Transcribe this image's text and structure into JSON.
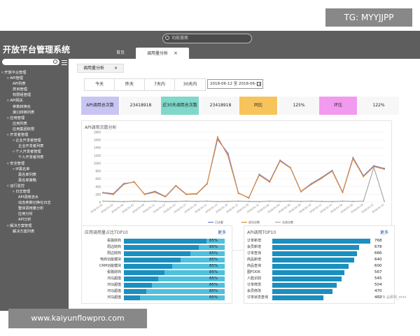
{
  "watermarks": {
    "top": "TG: MYYJJPP",
    "bottom": "www.kaiyunflowpro.com",
    "credit": "CSDN @慕锦_mini"
  },
  "app": {
    "title": "开放平台管理系统",
    "search_placeholder": "功能搜索"
  },
  "tabs": [
    {
      "label": "首页"
    },
    {
      "label": "调用量分析",
      "close": "×"
    }
  ],
  "sidebar": {
    "tree": [
      "▿ 开放平台管理",
      "▿ API管理",
      "API列表",
      "类目管理",
      "权限组管理",
      "▿ API网关",
      "参数转换化",
      "接口转换列表",
      "▿ 应用管理",
      "应用列表",
      "应用集团权限",
      "▿ 开发者管理",
      "▿ 企业开发者管理",
      "企业开发者列表",
      "▿ 个人开发者管理",
      "个人开发者列表",
      "▿ 安全管理",
      "▿ IP黑名单",
      "黑名单列表",
      "黑名单策略",
      "▿ 运行监控",
      "▿ 日志管理",
      "API调用流水",
      "动态参数切换化日志",
      "整体调用量分析",
      "应用分析",
      "API分析",
      "▿ 解决方案管理",
      "解决方案列表"
    ],
    "indents": [
      0,
      1,
      2,
      2,
      2,
      1,
      2,
      2,
      1,
      2,
      2,
      1,
      2,
      3,
      2,
      3,
      1,
      2,
      3,
      3,
      1,
      2,
      3,
      3,
      3,
      3,
      3,
      1,
      2
    ]
  },
  "subtab": {
    "label": "调用量分析",
    "close": "×"
  },
  "periods": [
    "今天",
    "昨天",
    "7天内",
    "30天内"
  ],
  "date_range": "2018-06-12 至 2018-06-12",
  "stats": [
    {
      "label": "API调用总次数",
      "color": "#c9c5f2"
    },
    {
      "label": "23418918",
      "color": "#f7f7f7"
    },
    {
      "label": "近30天调用总次数",
      "color": "#7fd8c9"
    },
    {
      "label": "23418918",
      "color": "#f7f7f7"
    },
    {
      "label": "同比",
      "color": "#f7c45c"
    },
    {
      "label": "125%",
      "color": "#f7f7f7"
    },
    {
      "label": "环比",
      "color": "#f29af0"
    },
    {
      "label": "122%",
      "color": "#f7f7f7"
    }
  ],
  "chart_data": {
    "type": "line",
    "title": "API调用次数分析",
    "ylim": [
      0,
      1800
    ],
    "yticks": [
      "1800",
      "1600",
      "1400",
      "1200",
      "1000",
      "800",
      "600",
      "400",
      "200",
      "0"
    ],
    "categories": [
      "2018-01-01",
      "2018-01-03",
      "2018-01-05",
      "2018-01-07",
      "2018-01-09",
      "2018-01-11",
      "2018-01-13",
      "2018-01-15",
      "2018-01-17",
      "2018-01-19",
      "2018-01-21",
      "2018-01-23",
      "2018-01-25",
      "2018-01-27",
      "2018-01-29",
      "2018-01-31",
      "2018-02-02",
      "2018-02-04",
      "2018-02-06",
      "2018-02-08",
      "2018-02-10",
      "2018-02-12",
      "2018-02-14",
      "2018-02-16",
      "2018-02-18",
      "2018-02-20",
      "2018-02-22",
      "2018-02-24"
    ],
    "series": [
      {
        "name": "日访客",
        "color": "#6c7bc8",
        "values": [
          250,
          220,
          480,
          520,
          210,
          280,
          150,
          430,
          210,
          220,
          480,
          1620,
          1260,
          240,
          110,
          720,
          540,
          1080,
          890,
          280,
          480,
          640,
          820,
          260,
          1150,
          680,
          940,
          870
        ]
      },
      {
        "name": "成功次数",
        "color": "#e08a3c",
        "values": [
          240,
          200,
          460,
          530,
          200,
          260,
          140,
          420,
          200,
          210,
          470,
          1680,
          1200,
          230,
          120,
          700,
          520,
          1060,
          880,
          270,
          460,
          620,
          800,
          250,
          1120,
          660,
          920,
          850
        ]
      },
      {
        "name": "无效次数",
        "color": "#a8a8a8",
        "values": [
          30,
          25,
          20,
          30,
          25,
          30,
          20,
          25,
          30,
          25,
          30,
          20,
          25,
          30,
          25,
          20,
          30,
          25,
          30,
          25,
          30,
          25,
          20,
          30,
          25,
          30,
          900,
          25
        ]
      }
    ]
  },
  "left_panel": {
    "title": "应用调用量占比TOP10",
    "more": "更多",
    "rows": [
      {
        "label": "看融财商",
        "pct": "85%",
        "fill": 0.82
      },
      {
        "label": "周边财商",
        "pct": "85%",
        "fill": 0.74
      },
      {
        "label": "周边财商",
        "pct": "85%",
        "fill": 0.66
      },
      {
        "label": "电商功能模块",
        "pct": "85%",
        "fill": 0.56
      },
      {
        "label": "CRM功能模块",
        "pct": "85%",
        "fill": 0.48
      },
      {
        "label": "看融财商",
        "pct": "85%",
        "fill": 0.4
      },
      {
        "label": "河马超值",
        "pct": "85%",
        "fill": 0.34
      },
      {
        "label": "河马超值",
        "pct": "85%",
        "fill": 0.28
      },
      {
        "label": "河马超值",
        "pct": "85%",
        "fill": 0.22
      },
      {
        "label": "河马超值",
        "pct": "85%",
        "fill": 0.16
      }
    ]
  },
  "right_panel": {
    "title": "API调用TOP10",
    "more": "更多",
    "rows": [
      {
        "label": "订单新增",
        "value": "768"
      },
      {
        "label": "会员新增",
        "value": "678"
      },
      {
        "label": "订单查询",
        "value": "666"
      },
      {
        "label": "商品新增",
        "value": "640"
      },
      {
        "label": "商品查询",
        "value": "600"
      },
      {
        "label": "图FOOK",
        "value": "567"
      },
      {
        "label": "人脸识别",
        "value": "545"
      },
      {
        "label": "订单修改",
        "value": "504"
      },
      {
        "label": "会员修改",
        "value": "470"
      },
      {
        "label": "订单状态查询",
        "value": "402"
      }
    ]
  }
}
